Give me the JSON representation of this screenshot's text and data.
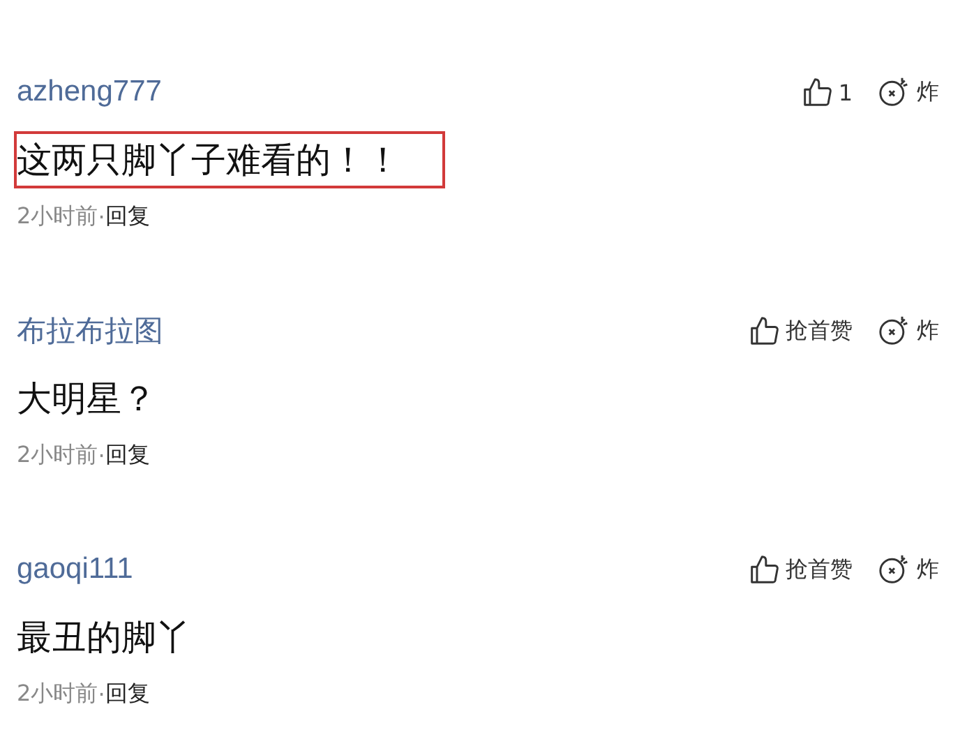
{
  "comments": [
    {
      "user": "azheng777",
      "like_label": "1",
      "bomb_label": "炸",
      "text": "这两只脚丫子难看的！！",
      "highlighted": true,
      "time": "2小时前",
      "separator": "·",
      "reply": "回复"
    },
    {
      "user": "布拉布拉图",
      "like_label": "抢首赞",
      "bomb_label": "炸",
      "text": "大明星？",
      "highlighted": false,
      "time": "2小时前",
      "separator": "·",
      "reply": "回复"
    },
    {
      "user": "gaoqi111",
      "like_label": "抢首赞",
      "bomb_label": "炸",
      "text": "最丑的脚丫",
      "highlighted": false,
      "time": "2小时前",
      "separator": "·",
      "reply": "回复"
    }
  ]
}
